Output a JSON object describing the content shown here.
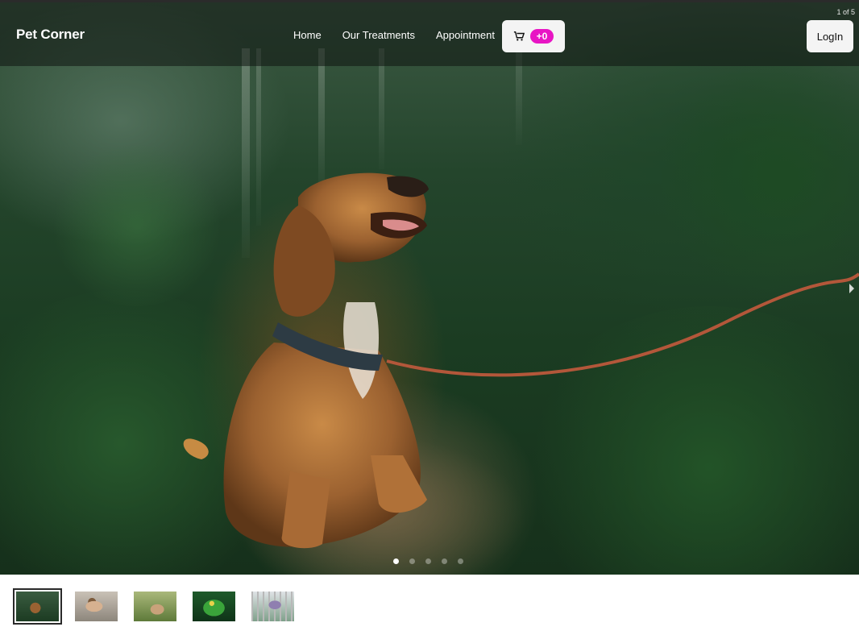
{
  "navbar": {
    "brand": "Pet Corner",
    "links": [
      "Home",
      "Our Treatments",
      "Appointment"
    ],
    "cart_count": "+0",
    "login_label": "LogIn"
  },
  "carousel": {
    "counter": "1 of 5",
    "slide_count": 5,
    "active_index": 0,
    "thumbnails": [
      "dog-on-forest-path",
      "cat-lying-down",
      "cat-in-grass",
      "green-parrot",
      "bird-in-cage"
    ]
  },
  "colors": {
    "badge": "#e815c4",
    "button_bg": "#f4f4f4",
    "navbar_overlay": "rgba(15,20,16,0.55)"
  }
}
